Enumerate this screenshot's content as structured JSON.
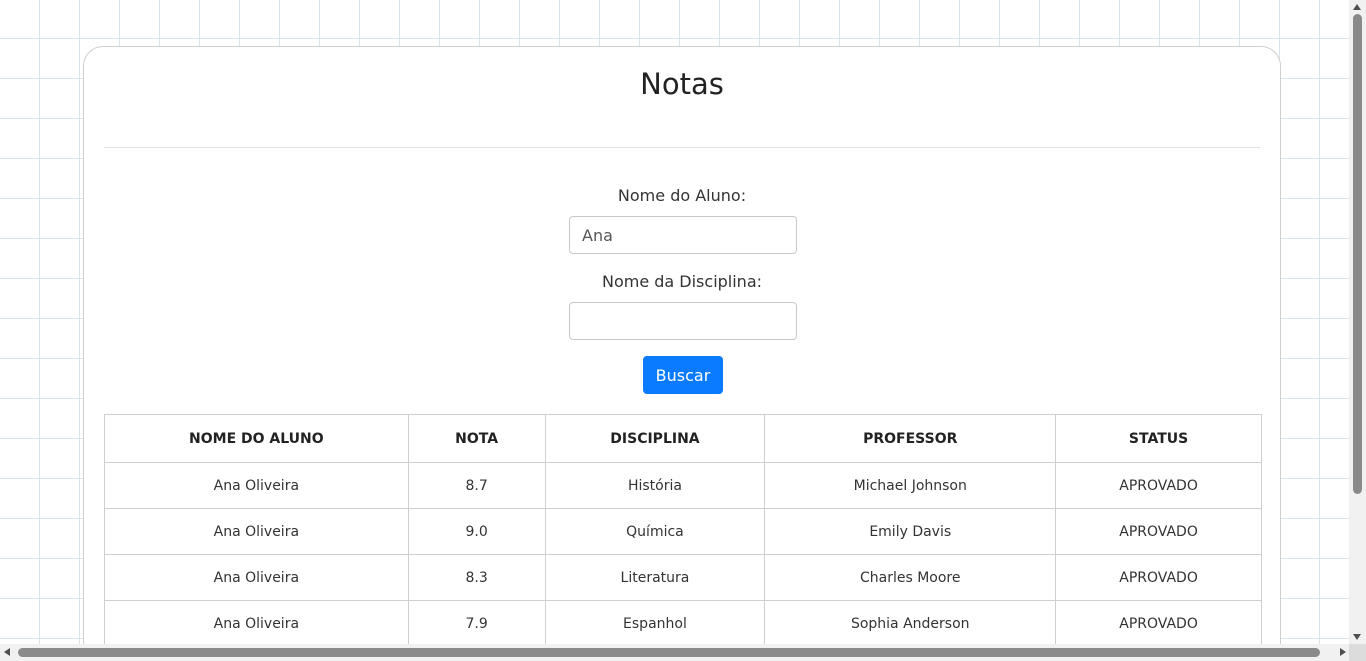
{
  "page": {
    "title": "Notas"
  },
  "form": {
    "student_label": "Nome do Aluno:",
    "student_value": "Ana",
    "discipline_label": "Nome da Disciplina:",
    "discipline_value": "",
    "search_button": "Buscar"
  },
  "table": {
    "headers": [
      "NOME DO ALUNO",
      "NOTA",
      "DISCIPLINA",
      "PROFESSOR",
      "STATUS"
    ],
    "rows": [
      [
        "Ana Oliveira",
        "8.7",
        "História",
        "Michael Johnson",
        "APROVADO"
      ],
      [
        "Ana Oliveira",
        "9.0",
        "Química",
        "Emily Davis",
        "APROVADO"
      ],
      [
        "Ana Oliveira",
        "8.3",
        "Literatura",
        "Charles Moore",
        "APROVADO"
      ],
      [
        "Ana Oliveira",
        "7.9",
        "Espanhol",
        "Sophia Anderson",
        "APROVADO"
      ]
    ]
  },
  "colors": {
    "accent": "#0a7bff",
    "grid": "#d9e3ea"
  }
}
